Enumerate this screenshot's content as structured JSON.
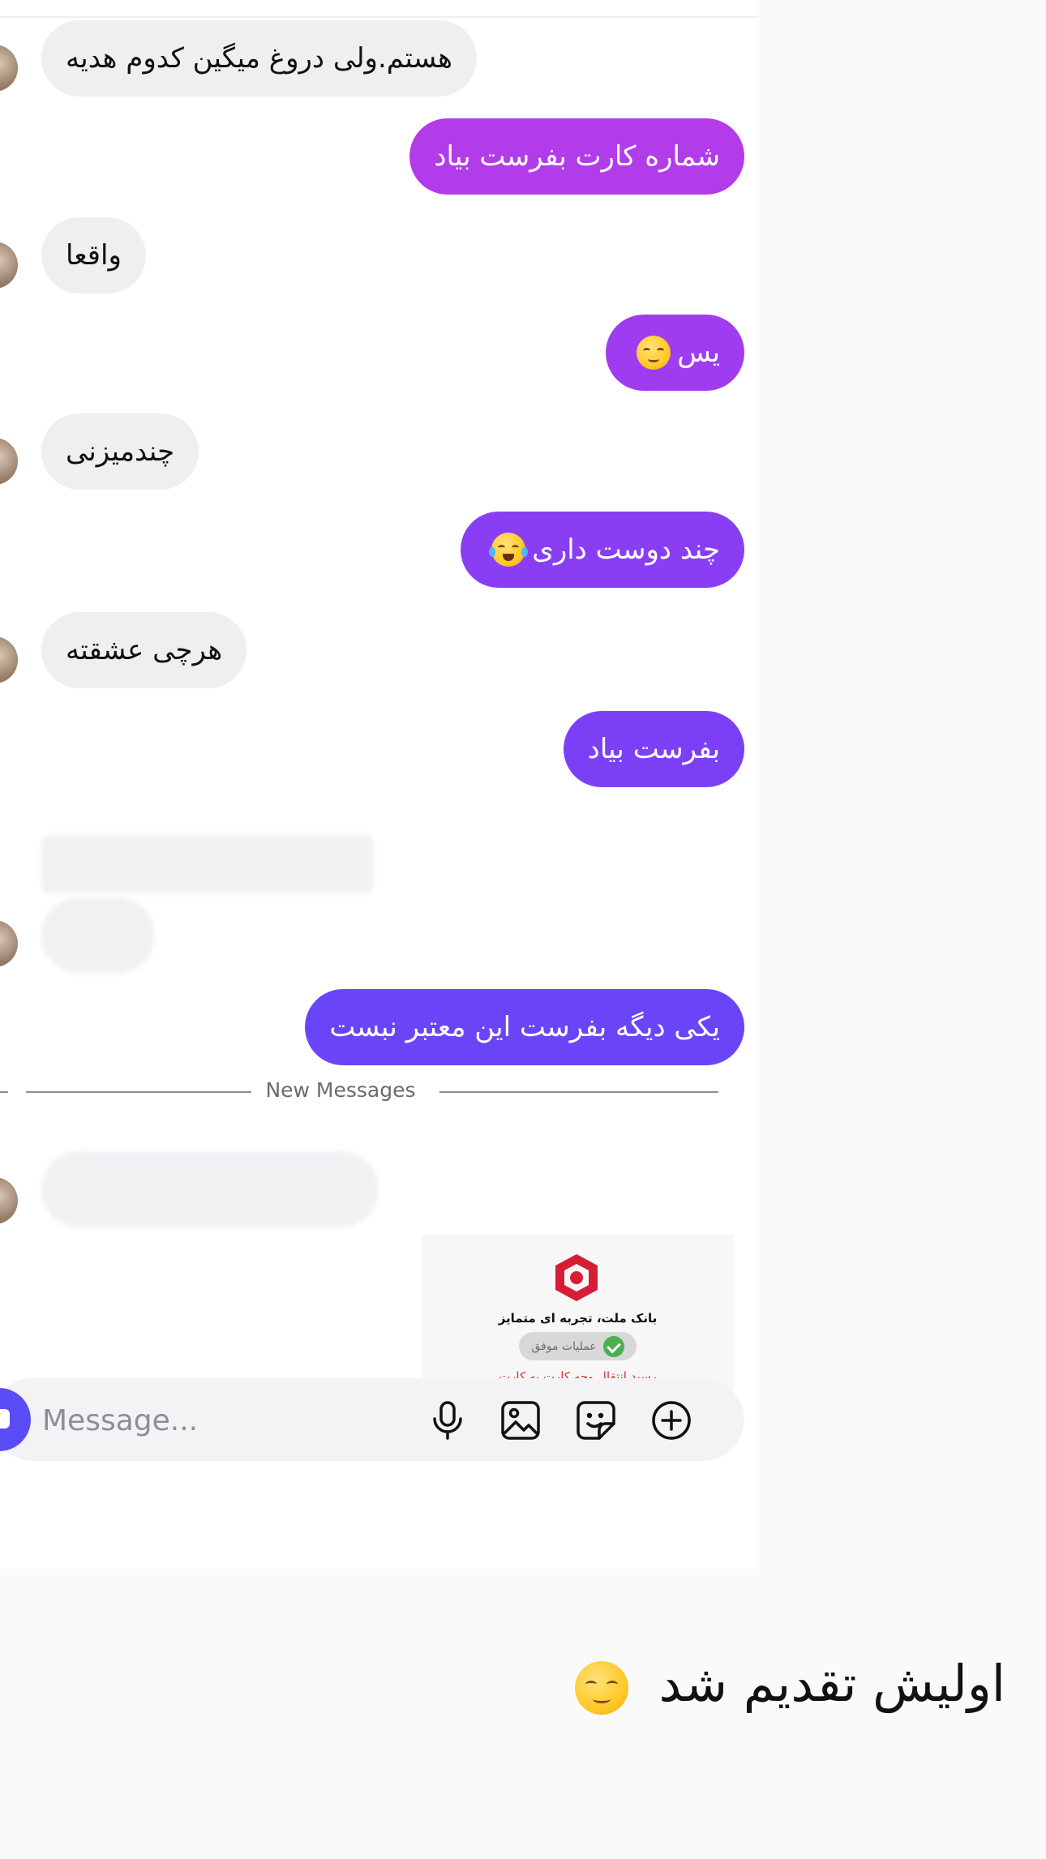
{
  "messages": [
    {
      "dir": "in",
      "text": "هستم.ولی دروغ میگین کدوم هدیه"
    },
    {
      "dir": "out",
      "text": "شماره کارت بفرست بیاد",
      "color": "#b33cea"
    },
    {
      "dir": "in",
      "text": "واقعا"
    },
    {
      "dir": "out",
      "text": "یس",
      "emoji": "relieved-face",
      "color": "#9f3cf0"
    },
    {
      "dir": "in",
      "text": "چندمیزنی"
    },
    {
      "dir": "out",
      "text": "چند دوست داری",
      "emoji": "tears-of-joy-face",
      "color": "#8a3ef4"
    },
    {
      "dir": "in",
      "text": "هرچی عشقته"
    },
    {
      "dir": "out",
      "text": "بفرست بیاد",
      "color": "#7b40f6"
    },
    {
      "dir": "out",
      "text": "یکی دیگه بفرست این معتبر نبست",
      "color": "#6a45f7"
    }
  ],
  "divider": {
    "label": "New Messages"
  },
  "receipt": {
    "bank_name": "بانک ملت، تجربه ای متمایز",
    "status": "عملیات موفق",
    "line": "رسید انتقال وجه کارت به کارت"
  },
  "composer": {
    "placeholder": "Message..."
  },
  "caption": {
    "text": "اولیش تقدیم شد",
    "emoji": "relieved-face"
  }
}
